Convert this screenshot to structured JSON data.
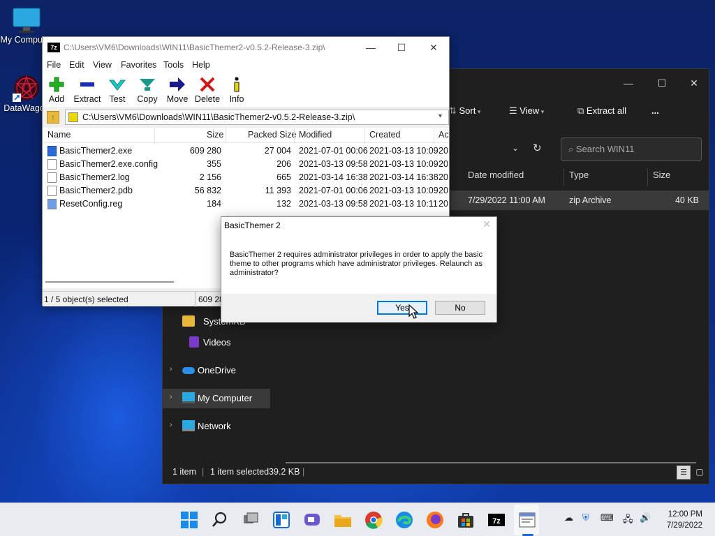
{
  "desktop": {
    "icons": [
      {
        "label": "My Computer"
      },
      {
        "label": "DataWagon"
      }
    ]
  },
  "explorer": {
    "cmds": {
      "sort": "Sort",
      "view": "View",
      "extract_all": "Extract all",
      "more": "..."
    },
    "search_placeholder": "Search WIN11",
    "columns": {
      "date": "Date modified",
      "type": "Type",
      "size": "Size"
    },
    "file": {
      "date": "7/29/2022 11:00 AM",
      "type": "zip Archive",
      "size": "40 KB"
    },
    "nav": [
      {
        "label": "SystemKB"
      },
      {
        "label": "Videos"
      },
      {
        "label": "OneDrive"
      },
      {
        "label": "My Computer"
      },
      {
        "label": "Network"
      }
    ],
    "status": {
      "count": "1 item",
      "selected": "1 item selected",
      "size": "39.2 KB"
    }
  },
  "sevenzip": {
    "title": "C:\\Users\\VM6\\Downloads\\WIN11\\BasicThemer2-v0.5.2-Release-3.zip\\",
    "menu": [
      "File",
      "Edit",
      "View",
      "Favorites",
      "Tools",
      "Help"
    ],
    "toolbar": [
      "Add",
      "Extract",
      "Test",
      "Copy",
      "Move",
      "Delete",
      "Info"
    ],
    "address": "C:\\Users\\VM6\\Downloads\\WIN11\\BasicThemer2-v0.5.2-Release-3.zip\\",
    "columns": [
      "Name",
      "Size",
      "Packed Size",
      "Modified",
      "Created",
      "Ac"
    ],
    "rows": [
      {
        "name": "BasicThemer2.exe",
        "size": "609 280",
        "packed": "27 004",
        "modified": "2021-07-01 00:06",
        "created": "2021-03-13 10:09",
        "ac": "20"
      },
      {
        "name": "BasicThemer2.exe.config",
        "size": "355",
        "packed": "206",
        "modified": "2021-03-13 09:58",
        "created": "2021-03-13 10:09",
        "ac": "20"
      },
      {
        "name": "BasicThemer2.log",
        "size": "2 156",
        "packed": "665",
        "modified": "2021-03-14 16:38",
        "created": "2021-03-14 16:38",
        "ac": "20"
      },
      {
        "name": "BasicThemer2.pdb",
        "size": "56 832",
        "packed": "11 393",
        "modified": "2021-07-01 00:06",
        "created": "2021-03-13 10:09",
        "ac": "20"
      },
      {
        "name": "ResetConfig.reg",
        "size": "184",
        "packed": "132",
        "modified": "2021-03-13 09:58",
        "created": "2021-03-13 10:11",
        "ac": "20"
      }
    ],
    "status": {
      "selected": "1 / 5 object(s) selected",
      "size": "609 28"
    }
  },
  "dialog": {
    "title": "BasicThemer 2",
    "close": "✕",
    "message": "BasicThemer 2 requires administrator privileges in order to apply the basic theme to other programs which have administrator privileges. Relaunch as administrator?",
    "yes": "Yes",
    "no": "No"
  },
  "taskbar": {
    "time": "12:00 PM",
    "date": "7/29/2022"
  }
}
